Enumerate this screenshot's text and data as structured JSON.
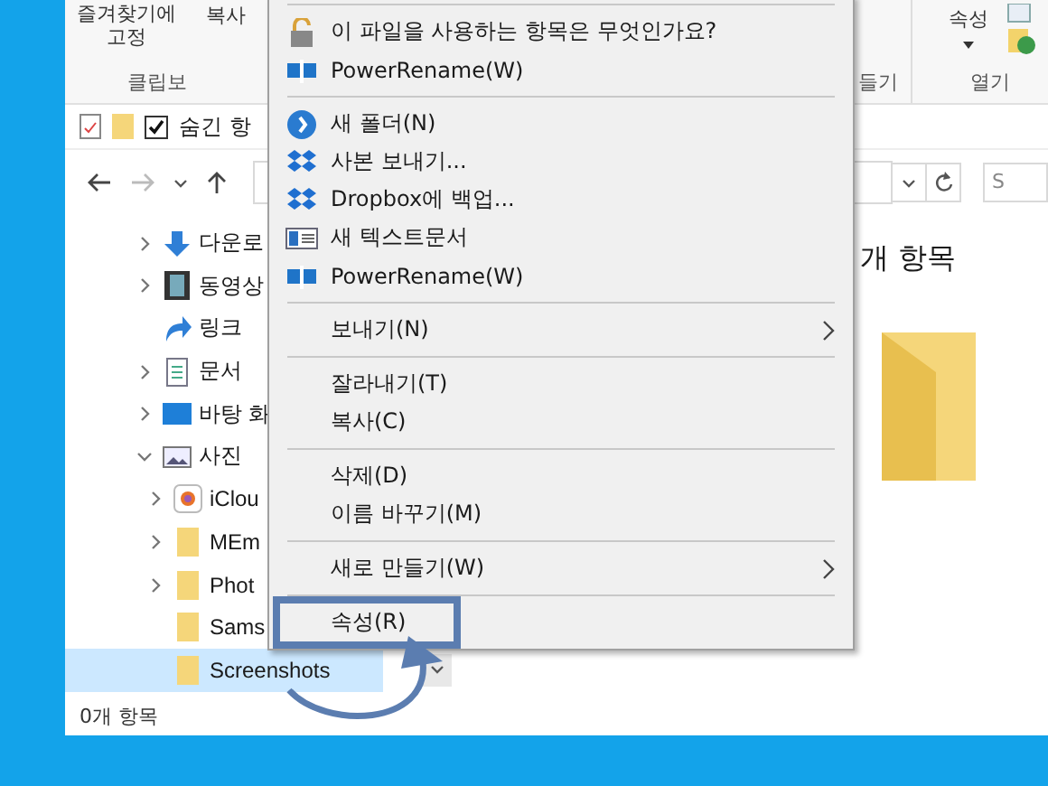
{
  "ribbon": {
    "left_buttons": [
      "즐겨찾기에 고정",
      "복사"
    ],
    "left_group": "클립보",
    "right_group_a": "들기",
    "properties_button": "속성",
    "right_group_b": "열기"
  },
  "quick_access": {
    "hidden_items_checked": true,
    "hidden_items_label": "숨긴 항"
  },
  "navigation": {
    "search_placeholder": "S"
  },
  "tree": [
    {
      "label": "다운로",
      "kind": "download",
      "expanded": false
    },
    {
      "label": "동영상",
      "kind": "video",
      "expanded": false
    },
    {
      "label": "링크",
      "kind": "link"
    },
    {
      "label": "문서",
      "kind": "document",
      "expanded": false
    },
    {
      "label": "바탕 화",
      "kind": "desktop",
      "expanded": false
    },
    {
      "label": "사진",
      "kind": "pictures",
      "expanded": true,
      "children": [
        {
          "label": "iClou",
          "kind": "photos",
          "expanded": false,
          "selected": false
        },
        {
          "label": "MEm",
          "kind": "folder",
          "expanded": false,
          "selected": false
        },
        {
          "label": "Phot",
          "kind": "folder",
          "expanded": false,
          "selected": false
        },
        {
          "label": "Sams",
          "kind": "folder",
          "selected": false
        },
        {
          "label": "Screenshots",
          "kind": "folder",
          "selected": true
        }
      ]
    }
  ],
  "content": {
    "item_count": "개 항목"
  },
  "status_bar": "0개 항목",
  "context_menu": [
    {
      "kind": "separator"
    },
    {
      "kind": "lock",
      "label": "이 파일을 사용하는 항목은 무엇인가요?"
    },
    {
      "kind": "rename",
      "label": "PowerRename(W)"
    },
    {
      "kind": "separator"
    },
    {
      "kind": "circle",
      "label": "새 폴더(N)"
    },
    {
      "kind": "dropbox",
      "label": "사본 보내기..."
    },
    {
      "kind": "dropbox",
      "label": "Dropbox에 백업..."
    },
    {
      "kind": "textdoc",
      "label": "새 텍스트문서"
    },
    {
      "kind": "rename",
      "label": "PowerRename(W)"
    },
    {
      "kind": "separator"
    },
    {
      "kind": "plain",
      "label": "보내기(N)",
      "submenu": true
    },
    {
      "kind": "separator"
    },
    {
      "kind": "plain",
      "label": "잘라내기(T)"
    },
    {
      "kind": "plain",
      "label": "복사(C)"
    },
    {
      "kind": "separator"
    },
    {
      "kind": "plain",
      "label": "삭제(D)"
    },
    {
      "kind": "plain",
      "label": "이름 바꾸기(M)"
    },
    {
      "kind": "separator"
    },
    {
      "kind": "plain",
      "label": "새로 만들기(W)",
      "submenu": true
    },
    {
      "kind": "separator"
    },
    {
      "kind": "plain",
      "label": "속성(R)",
      "highlighted": true
    }
  ]
}
